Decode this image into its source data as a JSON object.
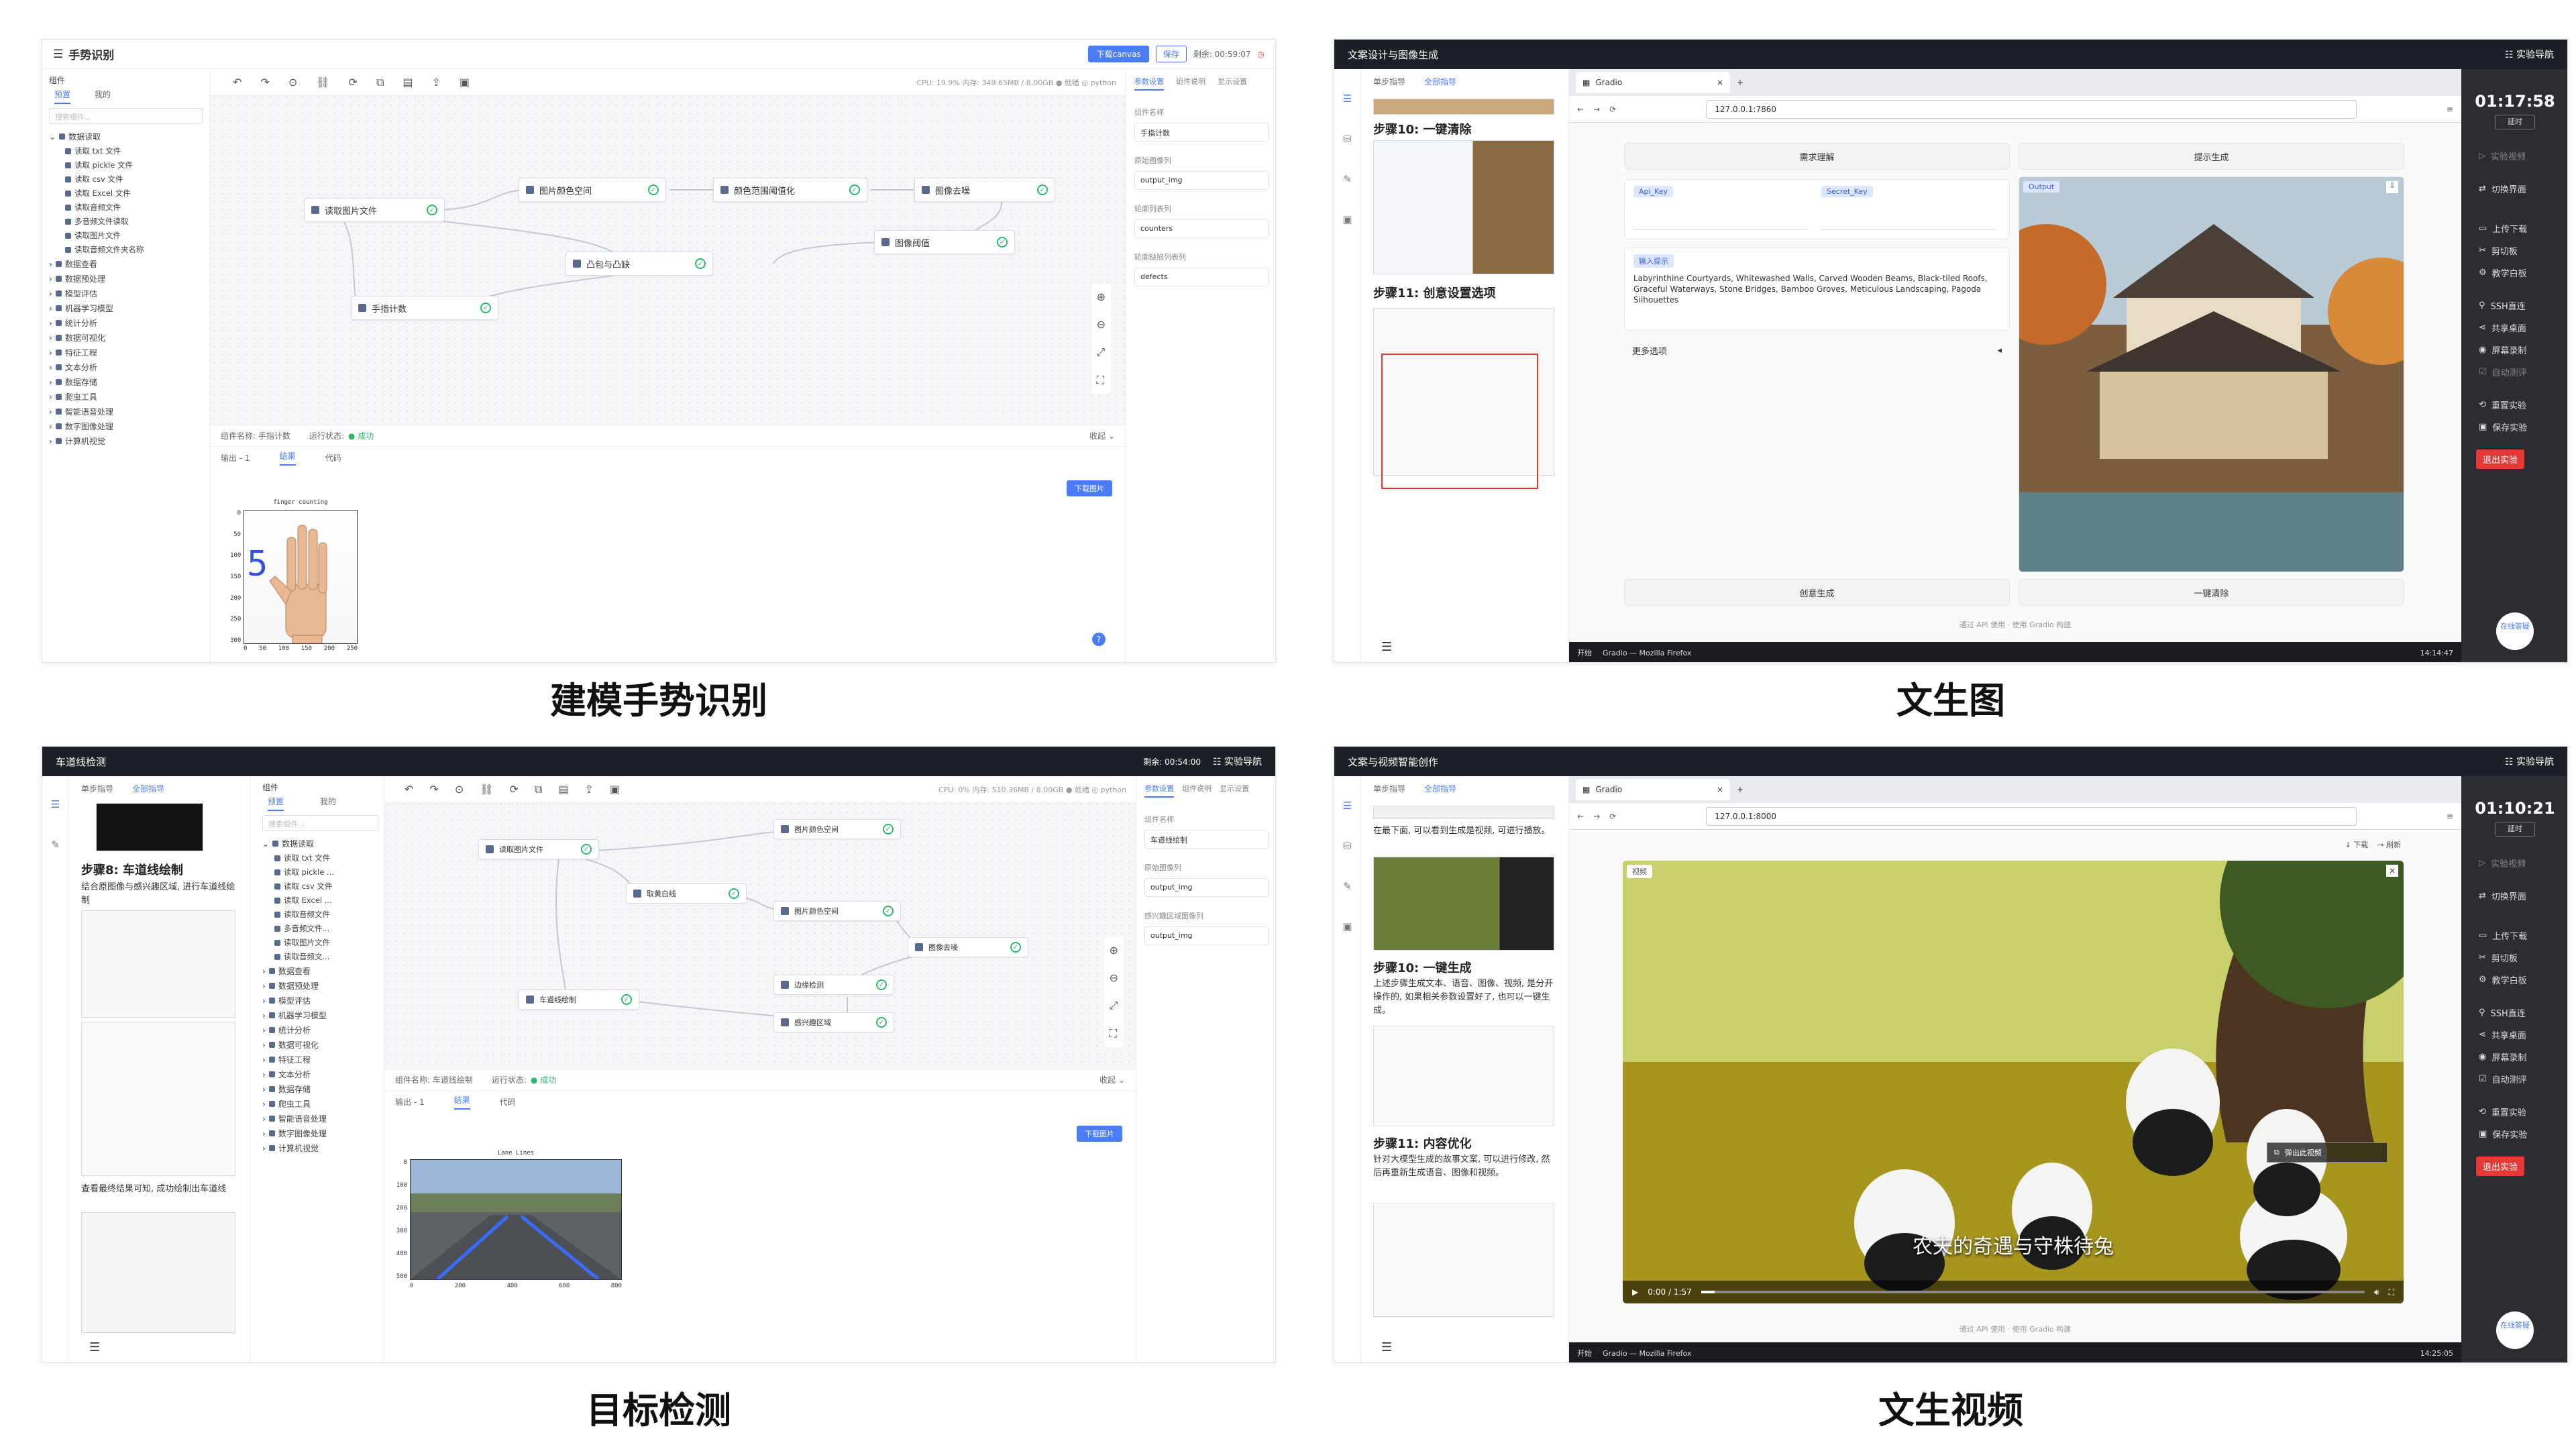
{
  "captions": {
    "p1": "建模手势识别",
    "p2": "文生图",
    "p3": "目标检测",
    "p4": "文生视频"
  },
  "modeling": {
    "sidebar_header": "组件",
    "tab_preset": "预置",
    "tab_mine": "我的",
    "search_placeholder": "搜索组件...",
    "data_read_group": "数据读取",
    "data_read_items": [
      "读取 txt 文件",
      "读取 pickle 文件",
      "读取 csv 文件",
      "读取 Excel 文件",
      "读取音频文件",
      "多音频文件读取",
      "读取图片文件",
      "读取音频文件夹名称"
    ],
    "data_read_items_short": [
      "读取 txt 文件",
      "读取 pickle ...",
      "读取 csv 文件",
      "读取 Excel ...",
      "读取音频文件",
      "多音频文件...",
      "读取图片文件",
      "读取音频文..."
    ],
    "groups": [
      "数据查看",
      "数据预处理",
      "模型评估",
      "机器学习模型",
      "统计分析",
      "数据可视化",
      "特征工程",
      "文本分析",
      "数据存储",
      "爬虫工具",
      "智能语音处理",
      "数字图像处理",
      "计算机视觉"
    ],
    "stats_1": "CPU: 19.9%  内存: 349.65MB / 8.00GB  ● 就绪  ◎ python",
    "stats_3": "CPU: 0%  内存: 510.36MB / 8.00GB  ● 就绪  ◎ python",
    "right_tabs": [
      "参数设置",
      "组件说明",
      "显示设置"
    ],
    "collapse": "收起 ⌄",
    "download_image": "下载图片",
    "output_label": "输出 - 1",
    "result_tab": "结果",
    "code_tab": "代码",
    "status_label": "运行状态:",
    "status_ok": "● 成功"
  },
  "p1": {
    "title": "手势识别",
    "download_canvas": "下载canvas",
    "save": "保存",
    "timer": "剩余: 00:59:07",
    "nodes": [
      "读取图片文件",
      "图片颜色空间",
      "颜色范围阈值化",
      "图像去噪",
      "图像阈值",
      "凸包与凸缺",
      "手指计数"
    ],
    "comp_name": "组件名称: 手指计数",
    "params": [
      {
        "label": "组件名称",
        "value": "手指计数"
      },
      {
        "label": "原始图像列",
        "value": "output_img"
      },
      {
        "label": "轮廓列表列",
        "value": "counters"
      },
      {
        "label": "轮廓缺陷列表列",
        "value": "defects"
      }
    ],
    "plot_title": "finger counting",
    "finger_count": "5",
    "yticks": [
      "0",
      "50",
      "100",
      "150",
      "200",
      "250",
      "300"
    ],
    "xticks": [
      "0",
      "50",
      "100",
      "150",
      "200",
      "250"
    ]
  },
  "p2": {
    "window_title": "文案设计与图像生成",
    "lab_nav": "☷ 实验导航",
    "guide_tabs": [
      "单步指导",
      "全部指导"
    ],
    "step10": "步骤10: 一键清除",
    "step11": "步骤11: 创意设置选项",
    "browser_tab": "Gradio",
    "url": "127.0.0.1:7860",
    "btn_demand": "需求理解",
    "btn_prompt": "提示生成",
    "api_key": "Api_Key",
    "secret_key": "Secret_Key",
    "input_prompt": "输入提示",
    "prompt_text": "Labyrinthine Courtyards, Whitewashed Walls, Carved Wooden Beams, Black-tiled Roofs, Graceful Waterways, Stone Bridges, Bamboo Groves, Meticulous Landscaping, Pagoda Silhouettes",
    "more_options": "更多选项",
    "output_label": "Output",
    "btn_create": "创意生成",
    "btn_clear": "一键清除",
    "footer": "通过 API 使用  ·  使用 Gradio 构建",
    "taskbar_start": "开始",
    "taskbar_app": "Gradio — Mozilla Firefox",
    "taskbar_time": "14:14:47",
    "clock": "01:17:58",
    "extend": "延时"
  },
  "p3": {
    "title": "车道线检测",
    "timer": "剩余: 00:54:00",
    "lab_nav": "☷ 实验导航",
    "guide_tabs": [
      "单步指导",
      "全部指导"
    ],
    "step8": "步骤8: 车道线绘制",
    "step8_desc": "结合原图像与感兴趣区域, 进行车道线绘制",
    "result_desc": "查看最终结果可知, 成功绘制出车道线",
    "nodes": [
      "读取图片文件",
      "图片颜色空间",
      "取黄白线",
      "图片颜色空间",
      "图像去噪",
      "边缘检测",
      "感兴趣区域",
      "车道线绘制"
    ],
    "comp_name": "组件名称: 车道线绘制",
    "params": [
      {
        "label": "组件名称",
        "value": "车道线绘制"
      },
      {
        "label": "原始图像列",
        "value": "output_img"
      },
      {
        "label": "感兴趣区域图像列",
        "value": "output_img"
      }
    ],
    "plot_title": "Lane Lines",
    "yticks": [
      "0",
      "100",
      "200",
      "300",
      "400",
      "500"
    ],
    "xticks": [
      "0",
      "200",
      "400",
      "600",
      "800"
    ]
  },
  "p4": {
    "window_title": "文案与视频智能创作",
    "lab_nav": "☷ 实验导航",
    "guide_tabs": [
      "单步指导",
      "全部指导"
    ],
    "intro": "在最下面, 可以看到生成是视频, 可进行播放。",
    "step10": "步骤10: 一键生成",
    "step10_desc": "上述步骤生成文本、语音、图像、视频, 是分开操作的, 如果相关参数设置好了, 也可以一键生成。",
    "step11": "步骤11: 内容优化",
    "step11_desc": "针对大模型生成的故事文案, 可以进行修改, 然后再重新生成语音、图像和视频。",
    "browser_tab": "Gradio",
    "url": "127.0.0.1:8000",
    "download": "↓ 下载",
    "refresh": "→ 刷新",
    "video_label": "视频",
    "subtitle": "农夫的奇遇与守株待兔",
    "popout": "弹出此视频",
    "time": "0:00 / 1:57",
    "footer": "通过 API 使用  ·  使用 Gradio 构建",
    "taskbar_start": "开始",
    "taskbar_app": "Gradio — Mozilla Firefox",
    "taskbar_time": "14:25:05",
    "clock": "01:10:21",
    "extend": "延时"
  },
  "dock": {
    "items": [
      "实验视频",
      "切换界面",
      "上传下载",
      "剪切板",
      "教学白板",
      "SSH直连",
      "共享桌面",
      "屏幕录制",
      "自动测评",
      "重置实验",
      "保存实验"
    ],
    "exit": "退出实验",
    "help": "在线答疑"
  },
  "colors": {
    "accent": "#4a7cf7",
    "success": "#2dbb6b",
    "dark": "#1d1f26",
    "danger": "#e53935"
  }
}
